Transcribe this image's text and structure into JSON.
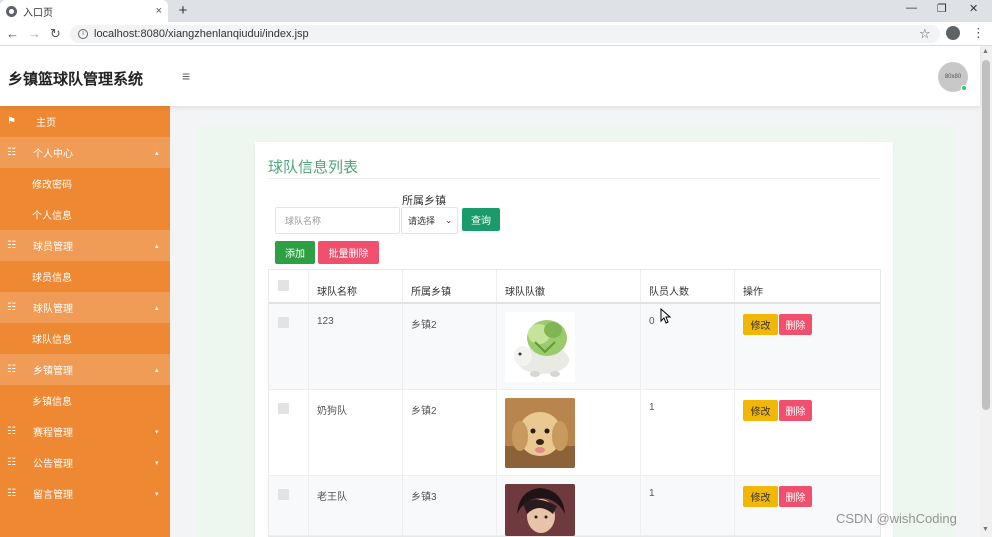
{
  "browser": {
    "tab_title": "入口页",
    "tab_close": "×",
    "new_tab": "+",
    "minimize": "—",
    "restore": "❐",
    "close": "✕",
    "back": "←",
    "forward": "→",
    "reload": "↻",
    "url": "localhost:8080/xiangzhenlanqiudui/index.jsp",
    "star": "☆",
    "menu": "⋮"
  },
  "header": {
    "brand": "乡镇篮球队管理系统",
    "menu_toggle": "≡",
    "avatar_text": "80x80"
  },
  "sidebar": {
    "items": [
      {
        "label": "主页",
        "icon": "flag-icon",
        "glyph": "⚑",
        "type": "top"
      },
      {
        "label": "个人中心",
        "icon": "grid-icon",
        "glyph": "☷",
        "type": "parent",
        "caret": "▴"
      },
      {
        "label": "修改密码",
        "type": "sub"
      },
      {
        "label": "个人信息",
        "type": "sub"
      },
      {
        "label": "球员管理",
        "icon": "grid-icon",
        "glyph": "☷",
        "type": "parent",
        "caret": "▴"
      },
      {
        "label": "球员信息",
        "type": "sub"
      },
      {
        "label": "球队管理",
        "icon": "grid-icon",
        "glyph": "☷",
        "type": "parent",
        "caret": "▴"
      },
      {
        "label": "球队信息",
        "type": "sub"
      },
      {
        "label": "乡镇管理",
        "icon": "grid-icon",
        "glyph": "☷",
        "type": "parent",
        "caret": "▴"
      },
      {
        "label": "乡镇信息",
        "type": "sub"
      },
      {
        "label": "赛程管理",
        "icon": "grid-icon",
        "glyph": "☷",
        "type": "collapsed",
        "caret": "▾"
      },
      {
        "label": "公告管理",
        "icon": "grid-icon",
        "glyph": "☷",
        "type": "collapsed",
        "caret": "▾"
      },
      {
        "label": "留言管理",
        "icon": "grid-icon",
        "glyph": "☷",
        "type": "collapsed",
        "caret": "▾"
      }
    ]
  },
  "main": {
    "title": "球队信息列表",
    "search_placeholder": "球队名称",
    "filter_label": "所属乡镇",
    "select_value": "请选择",
    "query_button": "查询",
    "add_button": "添加",
    "batch_delete_button": "批量删除",
    "table": {
      "headers": [
        "球队名称",
        "所属乡镇",
        "球队队徽",
        "队员人数",
        "操作"
      ],
      "rows": [
        {
          "name": "123",
          "town": "乡镇2",
          "logo": "cabbage-dog-image",
          "members": "0"
        },
        {
          "name": "奶狗队",
          "town": "乡镇2",
          "logo": "puppy-image",
          "members": "1"
        },
        {
          "name": "老王队",
          "town": "乡镇3",
          "logo": "person-image",
          "members": "1"
        }
      ],
      "edit_label": "修改",
      "delete_label": "删除"
    }
  },
  "watermark": "CSDN @wishCoding",
  "colors": {
    "sidebar": "#ee8833",
    "sidebar_parent": "#f09c56",
    "title_green": "#4fa47a",
    "query": "#1a9b6c",
    "add": "#2ea043",
    "danger": "#f0506e",
    "edit": "#f2b705"
  }
}
